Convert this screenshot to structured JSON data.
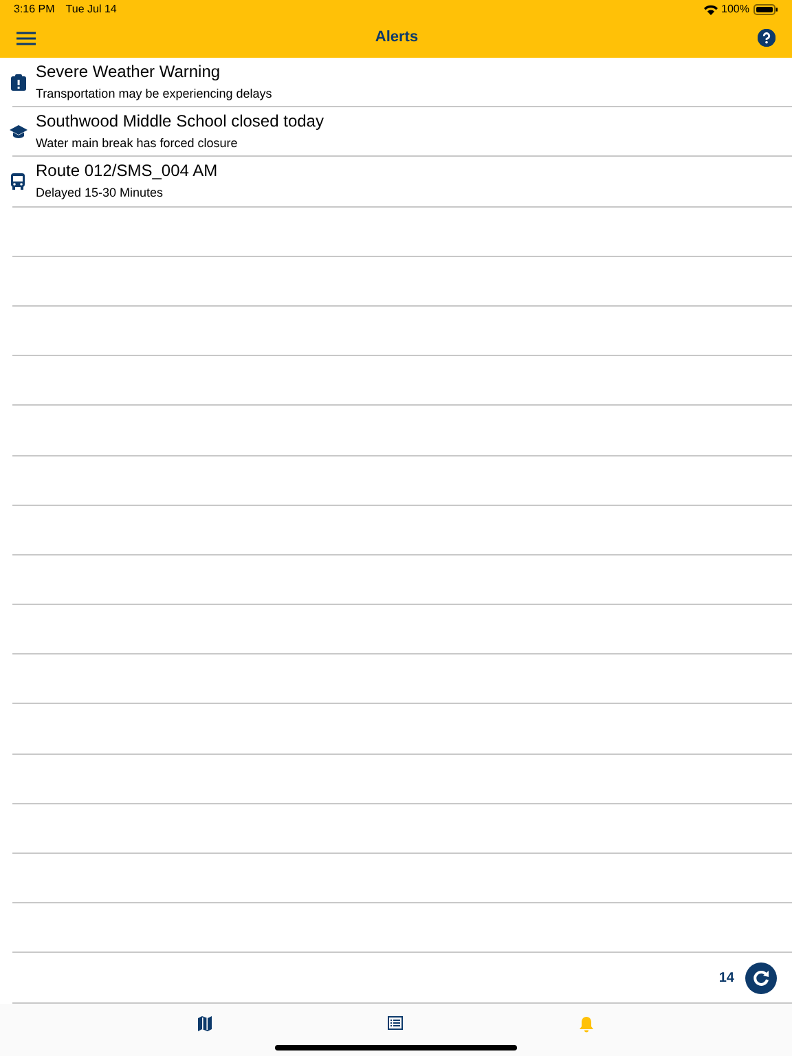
{
  "status_bar": {
    "time": "3:16 PM",
    "date": "Tue Jul 14",
    "battery": "100%"
  },
  "nav_bar": {
    "title": "Alerts"
  },
  "alerts": [
    {
      "kind": "warning",
      "title": "Severe Weather Warning",
      "message": "Transportation may be experiencing delays"
    },
    {
      "kind": "school",
      "title": "Southwood Middle School closed today",
      "message": "Water main break has forced closure"
    },
    {
      "kind": "bus",
      "title": "Route 012/SMS_004 AM",
      "message": "Delayed 15-30 Minutes"
    }
  ],
  "refresh": {
    "count": "14"
  },
  "tabs": [
    {
      "kind": "map",
      "selected": false
    },
    {
      "kind": "list",
      "selected": false
    },
    {
      "kind": "alerts",
      "selected": true
    }
  ]
}
